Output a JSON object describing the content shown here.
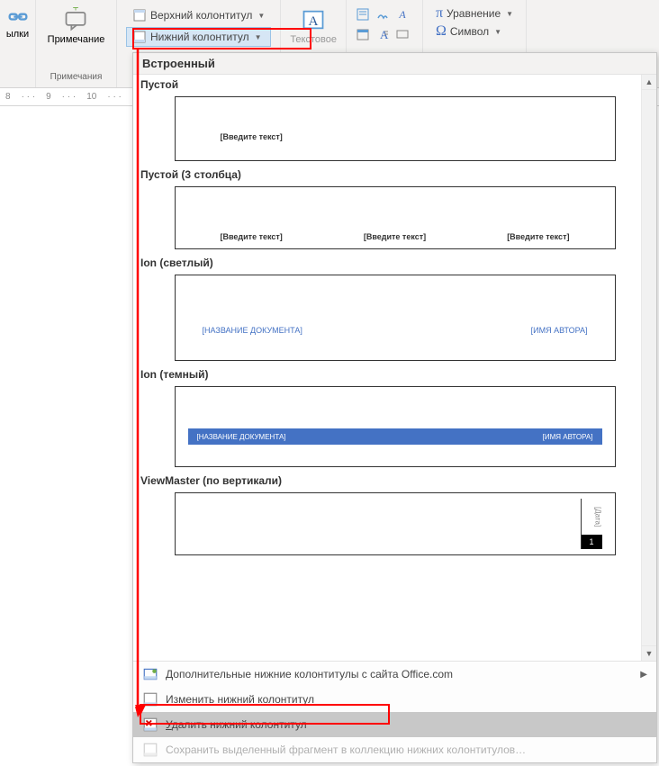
{
  "ribbon": {
    "links_label": "ылки",
    "comments_label": "Примечание",
    "comments_group": "Примечания",
    "header_btn": "Верхний колонтитул",
    "footer_btn": "Нижний колонтитул",
    "textbox_partial": "Текстовое",
    "equation_btn": "Уравнение",
    "symbol_btn": "Символ"
  },
  "ruler": {
    "marks": [
      "8",
      "9",
      "10"
    ]
  },
  "gallery": {
    "header": "Встроенный",
    "items": [
      {
        "title": "Пустой",
        "type": "empty",
        "placeholders": [
          "[Введите текст]"
        ]
      },
      {
        "title": "Пустой (3 столбца)",
        "type": "three_col",
        "placeholders": [
          "[Введите текст]",
          "[Введите текст]",
          "[Введите текст]"
        ]
      },
      {
        "title": "Ion (светлый)",
        "type": "ion_light",
        "left": "[НАЗВАНИЕ ДОКУМЕНТА]",
        "right": "[ИМЯ АВТОРА]"
      },
      {
        "title": "Ion (темный)",
        "type": "ion_dark",
        "left": "[НАЗВАНИЕ ДОКУМЕНТА]",
        "right": "[ИМЯ АВТОРА]"
      },
      {
        "title": "ViewMaster (по вертикали)",
        "type": "viewmaster",
        "date_label": "[Дата]",
        "page_num": "1"
      }
    ]
  },
  "menu": {
    "more_office": "Дополнительные нижние колонтитулы с сайта Office.com",
    "more_office_pre": "Д",
    "more_office_rest": "ополнительные нижние колонтитулы с сайта Office.com",
    "edit_footer": "Изменить нижний колонтитул",
    "edit_footer_pre": "Изменить ни",
    "edit_footer_ul": "ж",
    "edit_footer_rest": "ний колонтитул",
    "remove_footer": "Удалить нижний колонтитул",
    "remove_footer_pre": "",
    "remove_footer_ul": "У",
    "remove_footer_rest": "далить нижний колонтитул",
    "save_selection": "Сохранить выделенный фрагмент в коллекцию нижних колонтитулов…"
  }
}
